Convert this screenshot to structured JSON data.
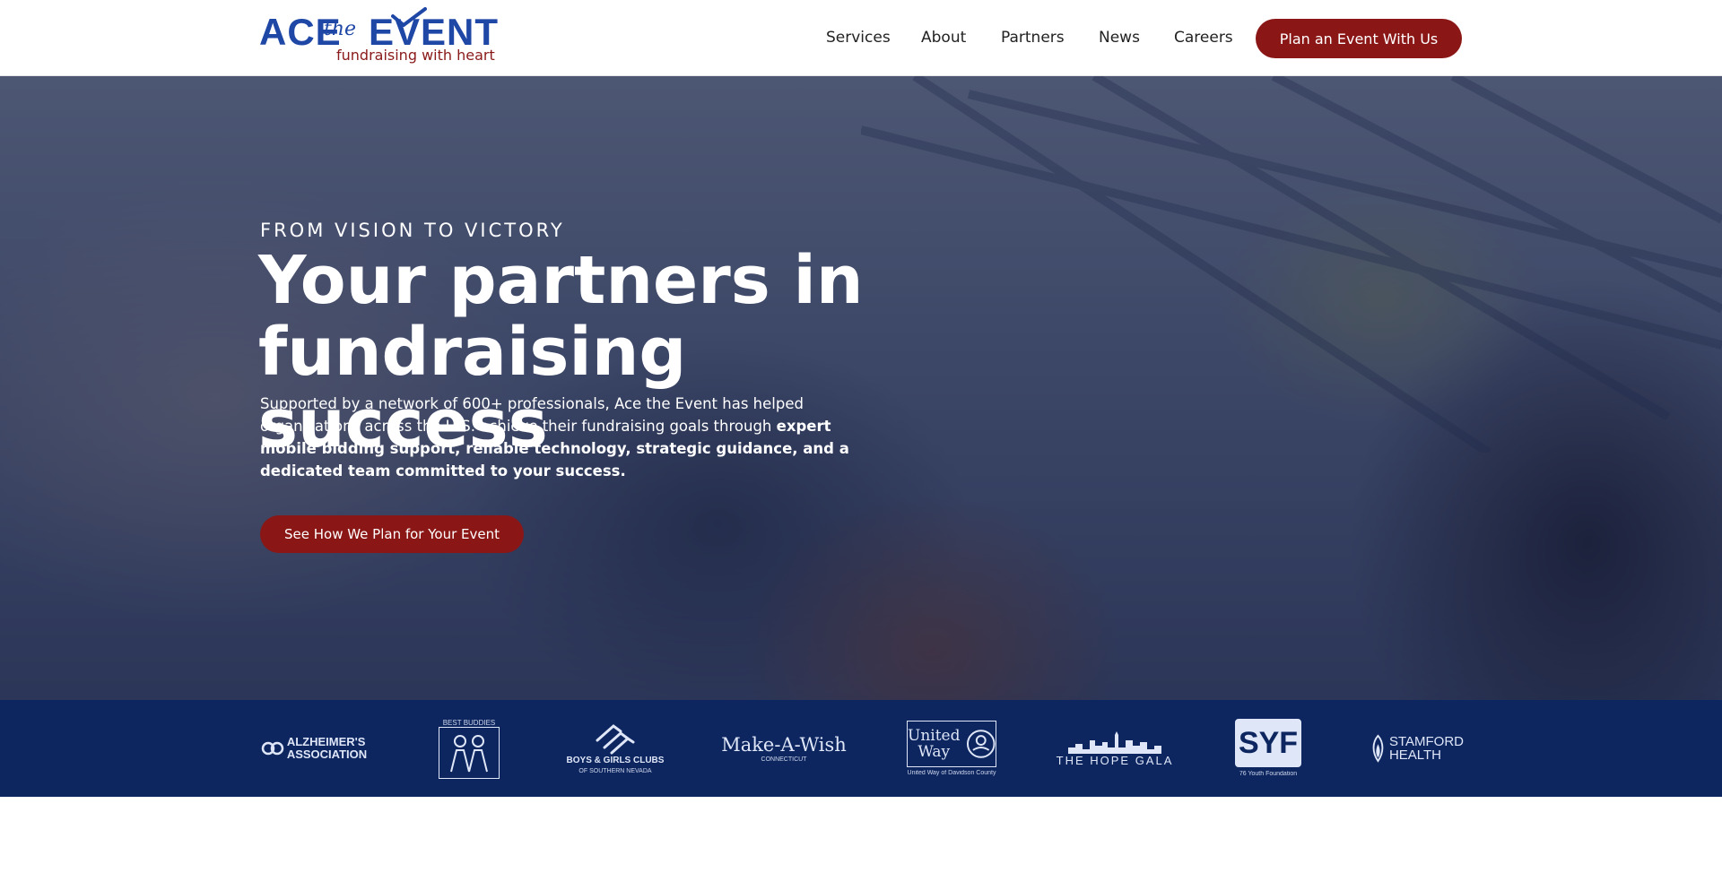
{
  "brand": {
    "logo_ace": "ACE",
    "logo_the": "the",
    "logo_event": "EVENT",
    "tagline": "fundraising with heart",
    "primary_color": "#1e47a6",
    "accent_color": "#8b1616"
  },
  "nav": {
    "items": [
      {
        "label": "Services"
      },
      {
        "label": "About"
      },
      {
        "label": "Partners"
      },
      {
        "label": "News"
      },
      {
        "label": "Careers"
      }
    ],
    "cta_label": "Plan an Event With Us"
  },
  "hero": {
    "eyebrow": "FROM VISION TO VICTORY",
    "headline_line1": "Your partners in",
    "headline_line2": "fundraising success",
    "body_plain": "Supported by a network of 600+ professionals, Ace the Event has helped organizations across the U.S. achieve their fundraising goals through ",
    "body_bold": "expert mobile bidding support, reliable technology, strategic guidance, and a dedicated team committed to your success.",
    "cta_label": "See How We Plan for Your Event"
  },
  "partners": [
    {
      "title": "ALZHEIMER'S",
      "title2": "ASSOCIATION",
      "icon": "alzheimers-logo"
    },
    {
      "title": "BEST BUDDIES",
      "icon": "best-buddies-logo"
    },
    {
      "title": "BOYS & GIRLS CLUBS",
      "sub": "OF SOUTHERN NEVADA",
      "icon": "boys-girls-clubs-logo"
    },
    {
      "title": "Make-A-Wish",
      "sub": "CONNECTICUT",
      "icon": "make-a-wish-logo"
    },
    {
      "title": "United",
      "title2": "Way",
      "sub": "United Way of Davidson County",
      "icon": "united-way-logo"
    },
    {
      "title": "THE HOPE GALA",
      "icon": "hope-gala-logo"
    },
    {
      "title": "SYF",
      "sub": "76 Youth Foundation",
      "icon": "syf-logo"
    },
    {
      "title": "STAMFORD",
      "title2": "HEALTH",
      "icon": "stamford-health-logo"
    }
  ]
}
